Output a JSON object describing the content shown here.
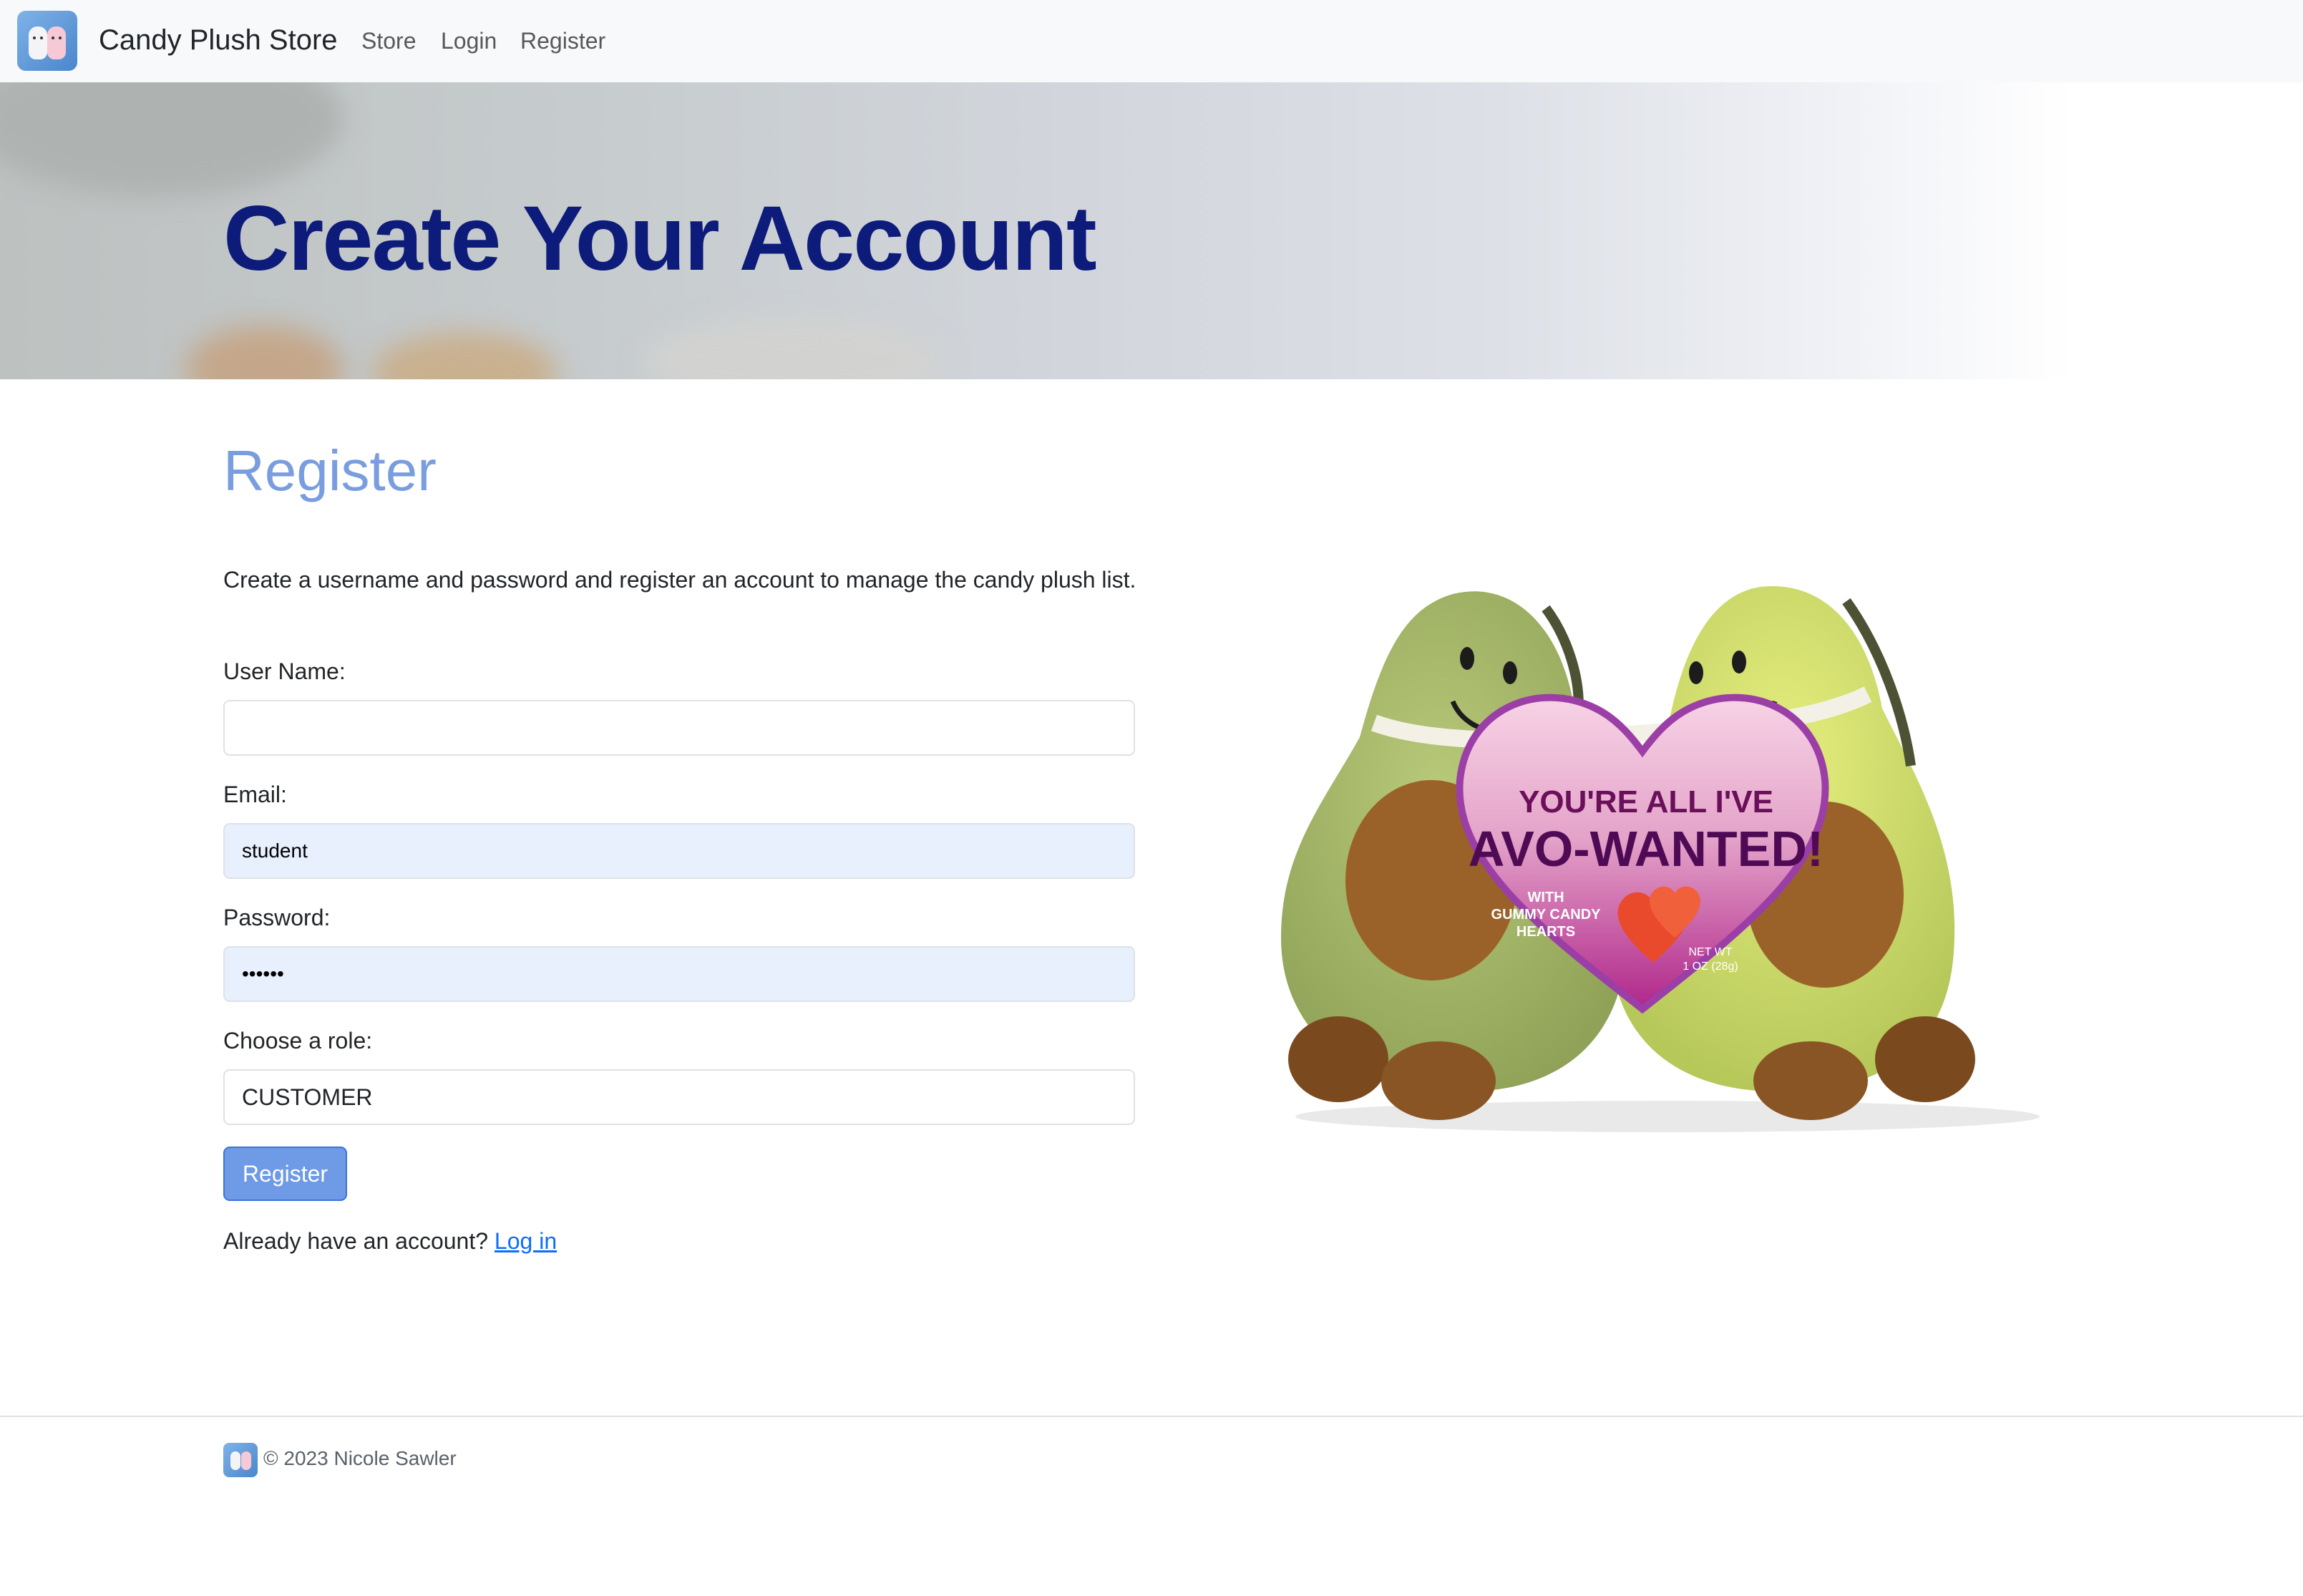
{
  "navbar": {
    "brand": "Candy Plush Store",
    "links": [
      "Store",
      "Login",
      "Register"
    ]
  },
  "hero": {
    "title": "Create Your Account"
  },
  "form": {
    "heading": "Register",
    "intro": "Create a username and password and register an account to manage the candy plush list.",
    "username_label": "User Name:",
    "username_value": "",
    "email_label": "Email:",
    "email_value": "student",
    "password_label": "Password:",
    "password_value": "••••••",
    "role_label": "Choose a role:",
    "role_value": "CUSTOMER",
    "submit_label": "Register",
    "account_prompt": "Already have an account?",
    "login_link": "Log in"
  },
  "product_image": {
    "heart_line1": "YOU'RE ALL I'VE",
    "heart_line2": "AVO-WANTED!",
    "heart_small1": "WITH",
    "heart_small2": "GUMMY CANDY",
    "heart_small3": "HEARTS",
    "net_wt1": "NET WT",
    "net_wt2": "1 OZ (28g)"
  },
  "footer": {
    "text": "© 2023 Nicole Sawler"
  },
  "colors": {
    "hero_title": "#0d1b7a",
    "section_title": "#7a9de0",
    "button": "#6e9ae6",
    "link": "#0d6efd",
    "autofill": "#e8f0fe"
  }
}
